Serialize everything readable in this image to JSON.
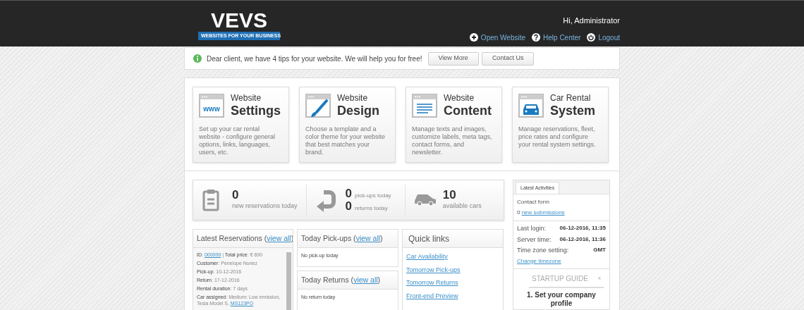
{
  "header": {
    "logo": "VEVS",
    "tagline": "WEBSITES FOR YOUR BUSINESS",
    "greeting": "Hi, Administrator",
    "links": [
      {
        "kind": "plus",
        "label": "Open Website"
      },
      {
        "kind": "help",
        "label": "Help Center"
      },
      {
        "kind": "power",
        "label": "Logout"
      }
    ]
  },
  "tip": {
    "text": "Dear client, we have 4 tips for your website. We will help you for free!",
    "buttons": [
      "View More",
      "Contact Us"
    ]
  },
  "cards": [
    {
      "kind": "www",
      "small": "Website",
      "big": "Settings",
      "text": "Set up your car rental website - configure general options, links, languages, users, etc.",
      "icon_text": "www"
    },
    {
      "kind": "brush",
      "small": "Website",
      "big": "Design",
      "text": "Choose a template and a color theme for your website that best matches your brand."
    },
    {
      "kind": "lines",
      "small": "Website",
      "big": "Content",
      "text": "Manage texts and images, customize labels, meta tags, contact forms, and newsletter."
    },
    {
      "kind": "car",
      "small": "Car Rental",
      "big": "System",
      "text": "Manage reservations, fleet, price rates and configure your rental system settings."
    }
  ],
  "stats": [
    {
      "kind": "clipboard",
      "lines": [
        {
          "number": "0",
          "label": "new reservations today"
        }
      ]
    },
    {
      "kind": "return",
      "lines": [
        {
          "number": "0",
          "label": "pick-ups today"
        },
        {
          "number": "0",
          "label": "returns today"
        }
      ]
    },
    {
      "kind": "car",
      "lines": [
        {
          "number": "10",
          "label": "available cars"
        }
      ]
    }
  ],
  "reservations": {
    "title": "Latest Reservations (",
    "link": "view all",
    "close": ")",
    "lines": [
      {
        "text": "**ID**: ",
        "link": "000009",
        "after": " | **Total price**: € 690"
      },
      {
        "text": "**Customer**: Penelope Nunez"
      },
      {
        "text": "**Pick-up**: 10-12-2016"
      },
      {
        "text": "**Return**: 17-12-2016"
      },
      {
        "text": "**Rental duration**: 7 days"
      },
      {
        "text": "**Car assigned**: Medium: Low emission, Tesla Model S, ",
        "link": "MS123PO"
      }
    ]
  },
  "pickups": {
    "title": "Today Pick-ups (",
    "link": "view all",
    "close": ")",
    "empty": "No pick-up today"
  },
  "returns": {
    "title": "Today Returns (",
    "link": "view all",
    "close": ")",
    "empty": "No return today"
  },
  "quick_links": {
    "title": "Quick links",
    "links": [
      "Car Availability",
      "Tomorrow Pick-ups",
      "Tomorrow Returns",
      "Front-end Preview"
    ]
  },
  "activities": {
    "tab": "Latest Activities",
    "contact_title": "Contact form",
    "count": "0",
    "submissions": "new submissions",
    "info": [
      {
        "label": "Last login:",
        "value": "06-12-2016, 11:35"
      },
      {
        "label": "Server time:",
        "value": "06-12-2016, 11:36"
      },
      {
        "label": "Time zone setting:",
        "value": "GMT"
      }
    ],
    "change": "Change timezone",
    "guide_title": "STARTUP GUIDE",
    "guide_close": "x",
    "guide_step": "1. Set your company profile"
  }
}
